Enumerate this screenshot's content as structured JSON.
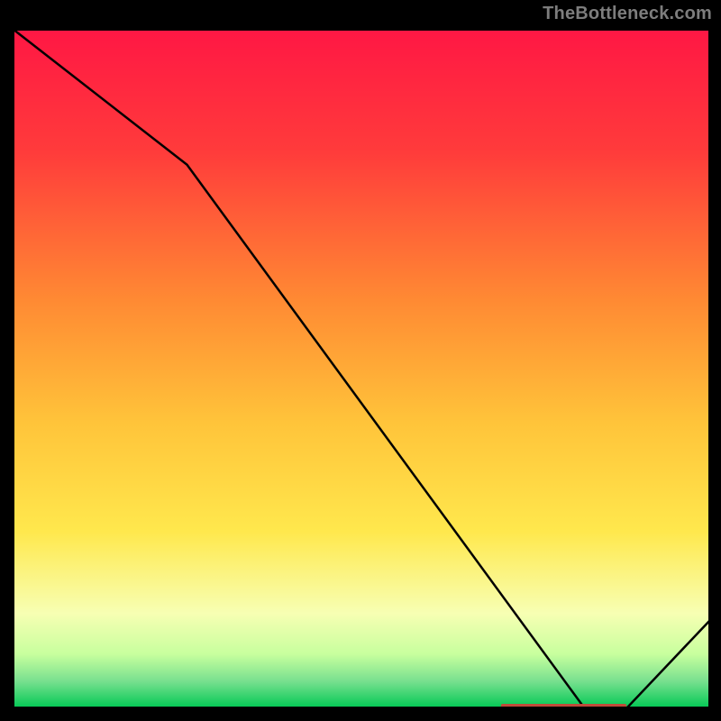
{
  "watermark": "TheBottleneck.com",
  "bottom_label": "",
  "colors": {
    "top": "#ff1744",
    "upper": "#ff5c33",
    "mid": "#ffb300",
    "lower_mid": "#ffe84d",
    "pale": "#f7ffb3",
    "greenish": "#78e08f",
    "green": "#00c853",
    "curve": "#000000",
    "marker": "#c04a3a",
    "border": "#000000",
    "watermark": "#7d7d7d"
  },
  "chart_data": {
    "type": "line",
    "title": "",
    "xlabel": "",
    "ylabel": "",
    "xlim": [
      0,
      100
    ],
    "ylim": [
      0,
      100
    ],
    "x": [
      0,
      25,
      82,
      88,
      100
    ],
    "values": [
      100,
      80,
      0,
      0,
      13
    ],
    "annotations": [
      {
        "text": "",
        "x_start": 70,
        "x_end": 88,
        "y": 0
      }
    ],
    "gradient_stops": [
      {
        "offset": 0.0,
        "color": "#ff1744"
      },
      {
        "offset": 0.18,
        "color": "#ff3b3b"
      },
      {
        "offset": 0.4,
        "color": "#ff8a33"
      },
      {
        "offset": 0.58,
        "color": "#ffc43a"
      },
      {
        "offset": 0.74,
        "color": "#ffe84d"
      },
      {
        "offset": 0.86,
        "color": "#f7ffb3"
      },
      {
        "offset": 0.92,
        "color": "#c8ff9e"
      },
      {
        "offset": 0.96,
        "color": "#78e08f"
      },
      {
        "offset": 1.0,
        "color": "#00c853"
      }
    ]
  }
}
